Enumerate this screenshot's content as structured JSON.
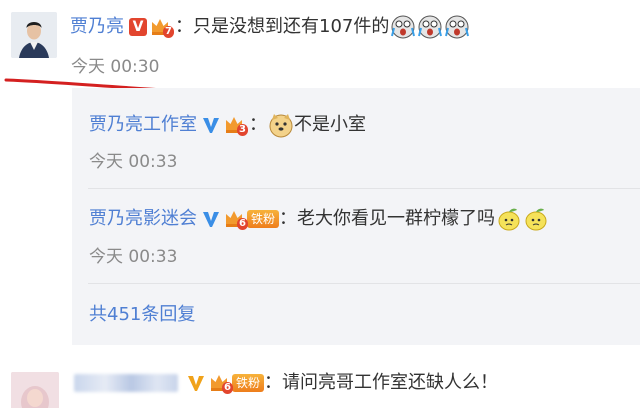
{
  "main_comment": {
    "author": "贾乃亮",
    "level": "7",
    "text": "：只是没想到还有107件的",
    "emojis": [
      "cry-laugh-emoji",
      "cry-laugh-emoji",
      "cry-laugh-emoji"
    ],
    "time": "今天 00:30"
  },
  "replies": [
    {
      "author": "贾乃亮工作室",
      "level": "3",
      "text": "不是小室",
      "emoji": "doge-emoji",
      "separator": "：",
      "time": "今天 00:33"
    },
    {
      "author": "贾乃亮影迷会",
      "level": "6",
      "fan_label": "铁粉",
      "text": "：老大你看见一群柠檬了吗",
      "emojis": [
        "lemon-emoji",
        "lemon-emoji"
      ],
      "time": "今天 00:33"
    }
  ],
  "more_replies": "共451条回复",
  "next_comment": {
    "level": "6",
    "fan_label": "铁粉",
    "text": "：请问亮哥工作室还缺人么！"
  },
  "colors": {
    "link": "#4f7fd3",
    "annotation_red": "#d42020",
    "reply_bg": "#f3f4f7"
  }
}
